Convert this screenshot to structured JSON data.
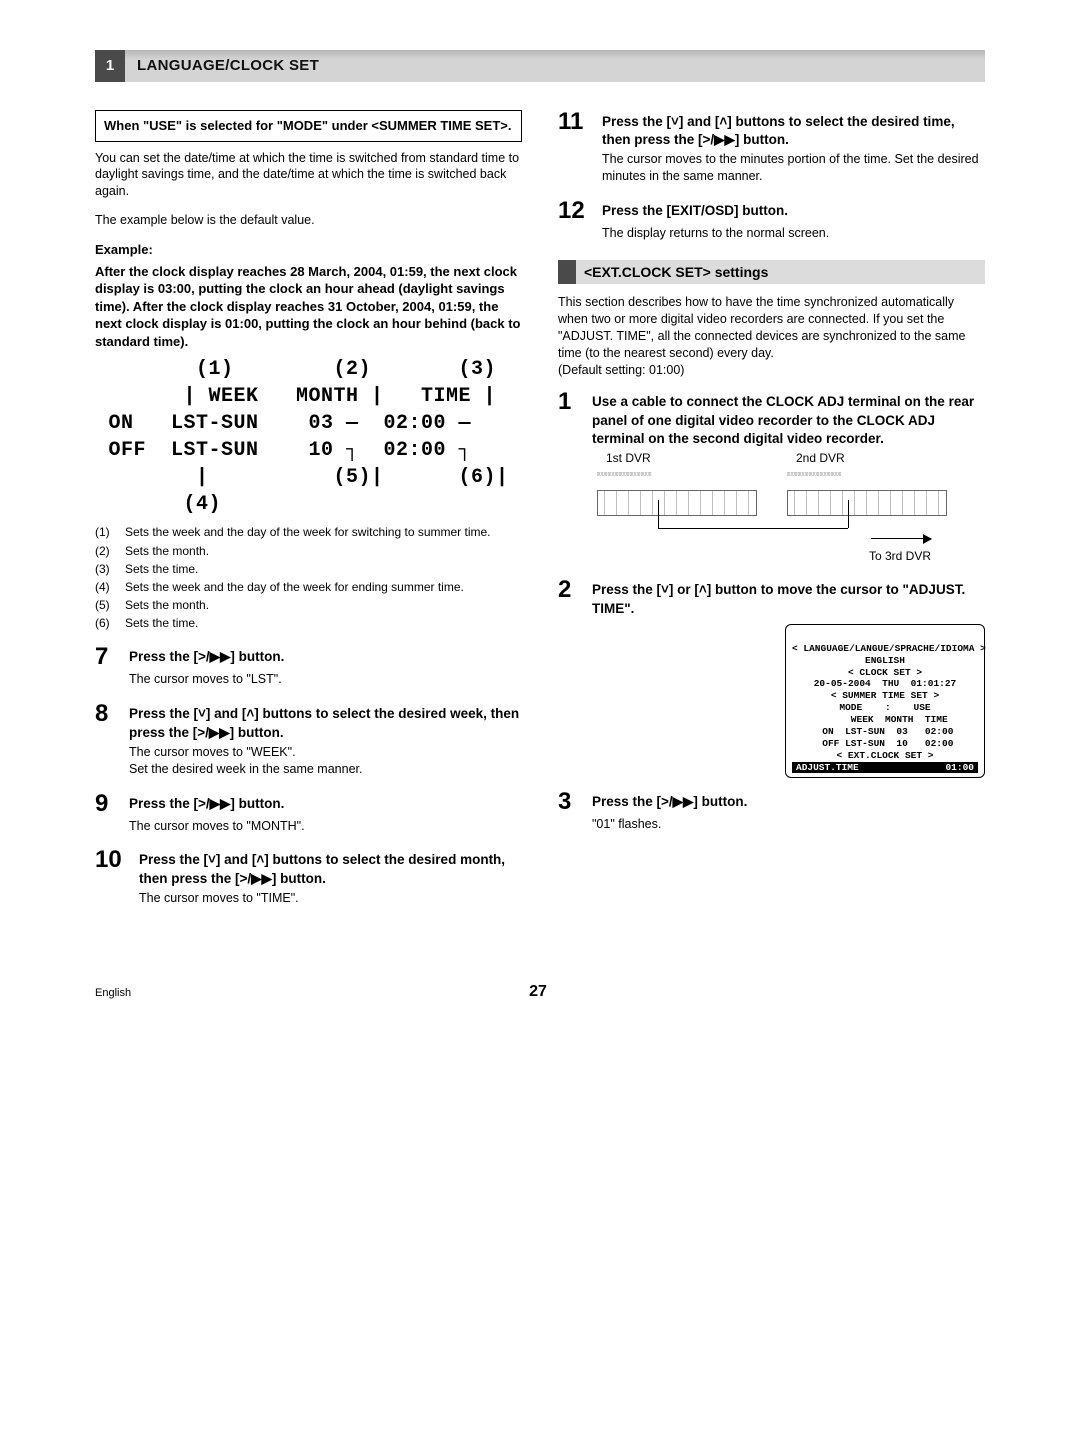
{
  "header": {
    "num": "1",
    "title": "LANGUAGE/CLOCK SET"
  },
  "left": {
    "boxedNote": "When \"USE\" is selected for \"MODE\" under <SUMMER TIME SET>.",
    "intro": "You can set the date/time at which the time is switched from standard time to daylight savings time, and the date/time at which the time is switched back again.",
    "exampleNote": "The example below is the default value.",
    "exampleLabel": "Example:",
    "exampleBold": "After the clock display reaches 28 March, 2004, 01:59, the next clock display is 03:00, putting the clock an hour ahead (daylight savings time). After the clock display reaches 31 October, 2004, 01:59, the next clock display is 01:00, putting the clock an hour behind (back to standard time).",
    "lcd": "       (1)        (2)       (3)\n      | WEEK   MONTH |   TIME |\nON   LST-SUN    03 —  02:00 —\nOFF  LST-SUN    10 ┐  02:00 ┐\n       |          (5)|      (6)|\n      (4)",
    "legend": [
      "Sets the week and the day of the week for switching to summer time.",
      "Sets the month.",
      "Sets the time.",
      "Sets the week and the day of the week for ending summer time.",
      "Sets the month.",
      "Sets the time."
    ],
    "steps": {
      "s7": {
        "num": "7",
        "head": "Press the [>/▶▶] button.",
        "body": "The cursor moves to \"LST\"."
      },
      "s8": {
        "num": "8",
        "head": "Press the [˅] and [˄] buttons to select the desired week, then press the [>/▶▶] button.",
        "body": "The cursor moves to \"WEEK\".\nSet the desired week in the same manner."
      },
      "s9": {
        "num": "9",
        "head": "Press the [>/▶▶] button.",
        "body": "The cursor moves to \"MONTH\"."
      },
      "s10": {
        "num": "10",
        "head": "Press the [˅] and [˄] buttons to select the desired month, then press the [>/▶▶] button.",
        "body": "The cursor moves to \"TIME\"."
      }
    }
  },
  "right": {
    "s11": {
      "num": "11",
      "head": "Press the [˅] and [˄] buttons to select the desired time, then press the [>/▶▶] button.",
      "body": "The cursor moves to the minutes portion of the time. Set the desired minutes in the same manner."
    },
    "s12": {
      "num": "12",
      "head": "Press the [EXIT/OSD] button.",
      "body": "The display returns to the normal screen."
    },
    "subHeader": "<EXT.CLOCK SET> settings",
    "extIntro": "This section describes how to have the time synchronized automatically when two or more digital video recorders are connected. If you set the \"ADJUST. TIME\", all the connected devices are synchronized to the same time (to the nearest second) every day.\n(Default setting: 01:00)",
    "s1": {
      "num": "1",
      "head": "Use a cable to connect the CLOCK ADJ terminal on the rear panel of one digital video recorder to the CLOCK ADJ terminal on the second digital video recorder."
    },
    "dvr": {
      "first": "1st DVR",
      "second": "2nd DVR",
      "to3rd": "To 3rd DVR"
    },
    "s2": {
      "num": "2",
      "head": "Press the [˅] or [˄] button to move the cursor to \"ADJUST. TIME\"."
    },
    "screen": {
      "l1": "< LANGUAGE/LANGUE/SPRACHE/IDIOMA >",
      "l2": "ENGLISH",
      "l3": "< CLOCK SET >",
      "l4": "20-05-2004  THU  01:01:27",
      "l5": "< SUMMER TIME SET >",
      "l6": "MODE    :    USE",
      "l7": "     WEEK  MONTH  TIME",
      "l8": " ON  LST-SUN  03   02:00",
      "l9": " OFF LST-SUN  10   02:00",
      "l10": "< EXT.CLOCK SET >",
      "invL": "ADJUST.TIME",
      "invR": "01:00"
    },
    "s3": {
      "num": "3",
      "head": "Press the [>/▶▶] button.",
      "body": "\"01\" flashes."
    }
  },
  "footer": {
    "lang": "English",
    "page": "27"
  }
}
